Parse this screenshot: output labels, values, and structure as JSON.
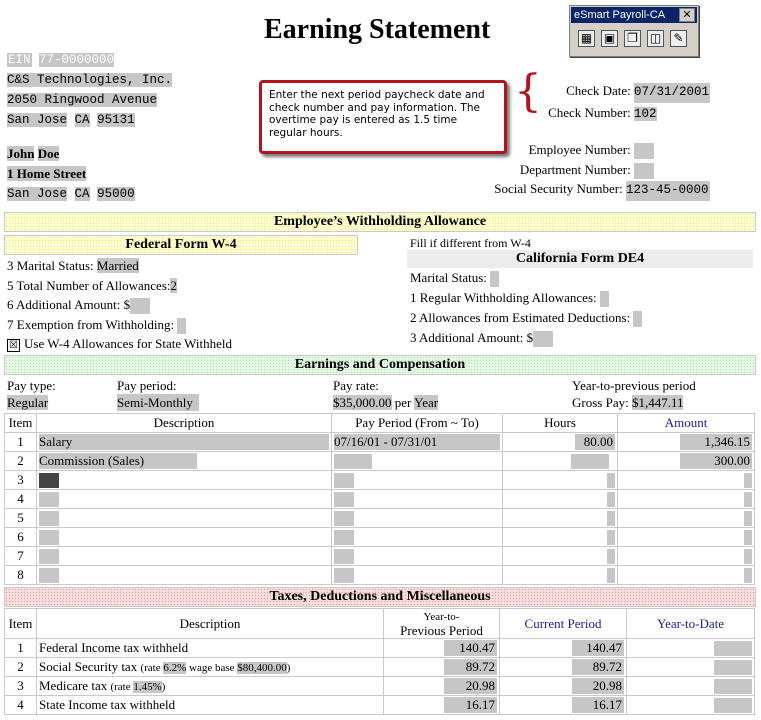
{
  "header": {
    "title": "Earning Statement",
    "ein_label": "EIN",
    "ein": "77-0000000",
    "company_name": "C&S Technologies, Inc.",
    "company_street": "2050 Ringwood Avenue",
    "company_city": "San Jose",
    "company_state": "CA",
    "company_zip": "95131",
    "employee_first": "John",
    "employee_last": "Doe",
    "employee_street": "1 Home Street",
    "employee_city": "San Jose",
    "employee_state": "CA",
    "employee_zip": "95000",
    "check_date_label": "Check Date:",
    "check_date": "07/31/2001",
    "check_number_label": "Check Number:",
    "check_number": "102",
    "employee_number_label": "Employee Number:",
    "department_number_label": "Department Number:",
    "ssn_label": "Social Security Number:",
    "ssn": "123-45-0000"
  },
  "callout": {
    "text": "Enter the next period paycheck date and check number and pay information. The overtime pay is entered as 1.5 time regular hours."
  },
  "toolbar": {
    "title": "eSmart Payroll-CA",
    "close": "✕",
    "icons": [
      "calculator-icon",
      "save-icon",
      "copy-icon",
      "preview-icon",
      "edit-icon"
    ]
  },
  "withholding": {
    "section_title": "Employee’s Withholding Allowance",
    "federal_title": "Federal Form W-4",
    "marital_label": "3  Marital Status:",
    "marital_value": "Married",
    "allowances_label": "5  Total Number of Allowances:",
    "allowances_value": "2",
    "additional_label": "6  Additional Amount: $",
    "exemption_label": "7  Exemption from Withholding:",
    "use_w4_label": "Use W-4 Allowances for State Withheld",
    "use_w4_checked": "☒",
    "fill_note": "Fill if different from W-4",
    "ca_title": "California Form DE4",
    "ca_marital_label": "Marital Status:",
    "ca_regular_label": "1  Regular Withholding Allowances:",
    "ca_estimated_label": "2  Allowances from Estimated Deductions:",
    "ca_additional_label": "3  Additional Amount: $"
  },
  "earnings": {
    "section_title": "Earnings and Compensation",
    "pay_type_label": "Pay type:",
    "pay_type": "Regular",
    "pay_period_label": "Pay period:",
    "pay_period": "Semi-Monthly",
    "pay_rate_label": "Pay rate:",
    "pay_rate": "$35,000.00",
    "per": "per",
    "rate_unit": "Year",
    "ytp_label": "Year-to-previous period",
    "gross_label": "Gross Pay:",
    "gross_value": "$1,447.11",
    "columns": [
      "Item",
      "Description",
      "Pay Period (From ~ To)",
      "Hours",
      "Amount"
    ],
    "rows": [
      {
        "item": "1",
        "desc": "Salary",
        "period": "07/16/01 - 07/31/01",
        "hours": "80.00",
        "amount": "1,346.15"
      },
      {
        "item": "2",
        "desc": "Commission (Sales)",
        "period": "",
        "hours": "",
        "amount": "300.00"
      },
      {
        "item": "3",
        "desc": "",
        "period": "",
        "hours": "",
        "amount": ""
      },
      {
        "item": "4",
        "desc": "",
        "period": "",
        "hours": "",
        "amount": ""
      },
      {
        "item": "5",
        "desc": "",
        "period": "",
        "hours": "",
        "amount": ""
      },
      {
        "item": "6",
        "desc": "",
        "period": "",
        "hours": "",
        "amount": ""
      },
      {
        "item": "7",
        "desc": "",
        "period": "",
        "hours": "",
        "amount": ""
      },
      {
        "item": "8",
        "desc": "",
        "period": "",
        "hours": "",
        "amount": ""
      }
    ]
  },
  "taxes": {
    "section_title": "Taxes, Deductions and Miscellaneous",
    "col_item": "Item",
    "col_desc": "Description",
    "col_prev_1": "Year-to-",
    "col_prev_2": "Previous Period",
    "col_current": "Current Period",
    "col_ytd": "Year-to-Date",
    "rows": [
      {
        "item": "1",
        "desc": "Federal Income tax withheld",
        "note": "",
        "prev": "140.47",
        "current": "140.47"
      },
      {
        "item": "2",
        "desc": "Social Security tax",
        "note_a": "(rate ",
        "rate": "6.2%",
        "note_b": " wage base ",
        "base": "$80,400.00",
        "note_c": ")",
        "prev": "89.72",
        "current": "89.72"
      },
      {
        "item": "3",
        "desc": "Medicare tax",
        "note_a": "(rate ",
        "rate": "1.45%",
        "note_c": ")",
        "prev": "20.98",
        "current": "20.98"
      },
      {
        "item": "4",
        "desc": "State Income tax withheld",
        "prev": "16.17",
        "current": "16.17"
      }
    ]
  }
}
